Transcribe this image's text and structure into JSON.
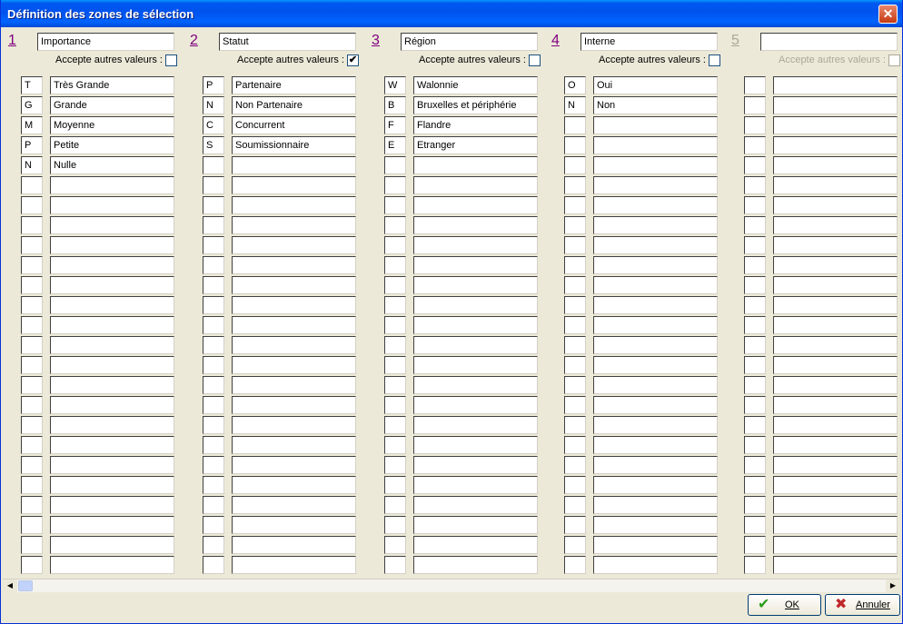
{
  "window": {
    "title": "Définition des zones de sélection",
    "close_glyph": "✕"
  },
  "accept_label": "Accepte autres valeurs :",
  "columns": [
    {
      "number": "1",
      "title": "Importance",
      "accept_checked": false,
      "enabled": true,
      "entries": [
        {
          "code": "T",
          "label": "Très Grande"
        },
        {
          "code": "G",
          "label": "Grande"
        },
        {
          "code": "M",
          "label": "Moyenne"
        },
        {
          "code": "P",
          "label": "Petite"
        },
        {
          "code": "N",
          "label": "Nulle"
        }
      ]
    },
    {
      "number": "2",
      "title": "Statut",
      "accept_checked": true,
      "enabled": true,
      "entries": [
        {
          "code": "P",
          "label": "Partenaire"
        },
        {
          "code": "N",
          "label": "Non Partenaire"
        },
        {
          "code": "C",
          "label": "Concurrent"
        },
        {
          "code": "S",
          "label": "Soumissionnaire"
        }
      ]
    },
    {
      "number": "3",
      "title": "Région",
      "accept_checked": false,
      "enabled": true,
      "entries": [
        {
          "code": "W",
          "label": "Walonnie"
        },
        {
          "code": "B",
          "label": "Bruxelles et périphérie"
        },
        {
          "code": "F",
          "label": "Flandre"
        },
        {
          "code": "E",
          "label": "Etranger"
        }
      ]
    },
    {
      "number": "4",
      "title": "Interne",
      "accept_checked": false,
      "enabled": true,
      "entries": [
        {
          "code": "O",
          "label": "Oui"
        },
        {
          "code": "N",
          "label": "Non"
        }
      ]
    },
    {
      "number": "5",
      "title": "",
      "accept_checked": false,
      "enabled": false,
      "entries": []
    }
  ],
  "check_glyph": "✔",
  "buttons": {
    "ok": {
      "label": "OK",
      "icon": "check-icon",
      "glyph": "✔",
      "color": "#2a9d1a"
    },
    "cancel": {
      "label": "Annuler",
      "icon": "cross-icon",
      "glyph": "✖",
      "color": "#c0282a"
    }
  },
  "scrollbar": {
    "left_glyph": "◀",
    "right_glyph": "▶"
  }
}
